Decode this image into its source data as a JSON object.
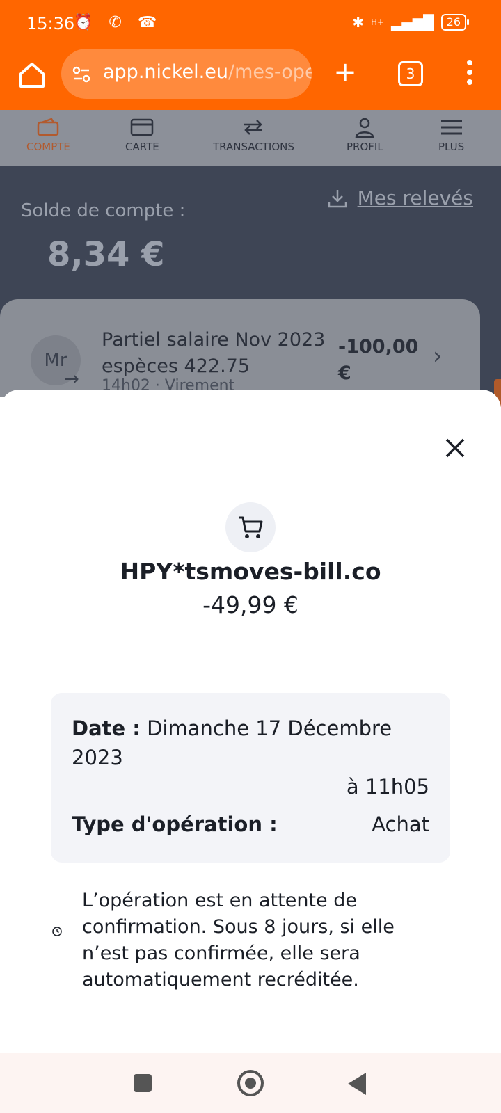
{
  "status_bar": {
    "time": "15:36",
    "left_icons": "⏰ ✆ ☎",
    "network": "H+",
    "battery": "26"
  },
  "browser": {
    "url_main": "app.nickel.eu",
    "url_rest": "/mes-ope",
    "tab_count": "3"
  },
  "app_nav": {
    "items": [
      {
        "label": "COMPTE"
      },
      {
        "label": "CARTE"
      },
      {
        "label": "TRANSACTIONS"
      },
      {
        "label": "PROFIL"
      },
      {
        "label": "PLUS"
      }
    ]
  },
  "account": {
    "solde_label": "Solde de compte :",
    "solde_value": "8,34 €",
    "releves_label": "Mes relevés"
  },
  "transaction_card": {
    "avatar": "Mr",
    "title_line1": "Partiel salaire Nov 2023",
    "title_line2": "espèces 422.75",
    "subtitle": "14h02 · Virement",
    "amount_line1": "-100,00",
    "amount_line2": "€"
  },
  "sheet": {
    "merchant": "HPY*tsmoves-bill.co",
    "amount": "-49,99 €",
    "date_label": "Date :",
    "date_value_line1": "Dimanche 17 Décembre 2023",
    "date_value_line2": "à 11h05",
    "type_label": "Type d'opération :",
    "type_value": "Achat",
    "pending_text": "L’opération est en attente de confirmation. Sous 8 jours, si elle n’est pas confirmée, elle sera automatiquement recréditée."
  },
  "icons": {
    "home": "home-icon",
    "site-settings": "site-settings-icon",
    "new-tab": "plus-icon",
    "tabs": "tabs-icon",
    "menu": "more-vert-icon",
    "close": "close-icon",
    "cart": "cart-icon",
    "clock": "clock-icon",
    "download": "download-icon"
  },
  "colors": {
    "brand_orange": "#ff6600",
    "overlay_dark": "#3e4555",
    "sheet_bg": "#ffffff",
    "info_box_bg": "#f3f4f8"
  }
}
